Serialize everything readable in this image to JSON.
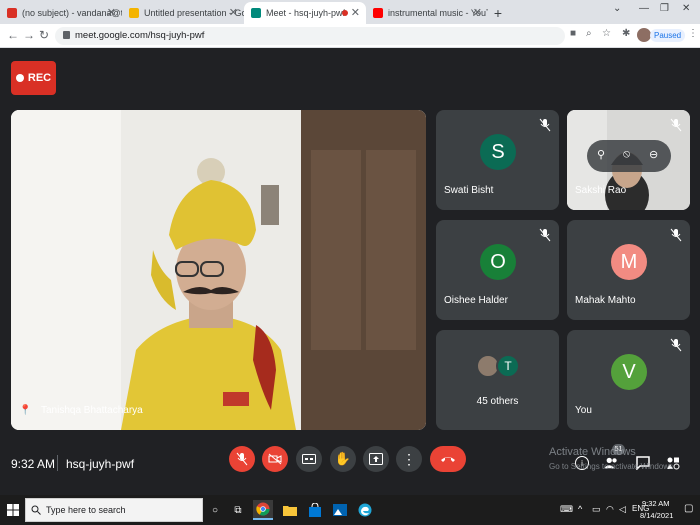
{
  "browser": {
    "tabs": [
      {
        "title": "(no subject) - vandana@theindia",
        "favicon_color": "#d93025",
        "active": false
      },
      {
        "title": "Untitled presentation - Google S",
        "favicon_color": "#f4b400",
        "active": false
      },
      {
        "title": "Meet - hsq-juyh-pwf",
        "favicon_color": "#00897b",
        "active": true
      },
      {
        "title": "instrumental music - YouTube",
        "favicon_color": "#ff0000",
        "active": false
      }
    ],
    "new_tab": "+",
    "url": "meet.google.com/hsq-juyh-pwf",
    "profile_status": "Paused"
  },
  "meet": {
    "rec_label": "REC",
    "main_participant": "Tanishqa Bhattacharya",
    "participants": [
      {
        "name": "Swati Bisht",
        "initial": "S",
        "color": "#0b6b54"
      },
      {
        "name": "Sakshi Rao",
        "initial": "",
        "color": "#d9d9d9"
      },
      {
        "name": "Oishee Halder",
        "initial": "O",
        "color": "#188038"
      },
      {
        "name": "Mahak Mahto",
        "initial": "M",
        "color": "#f28b82"
      },
      {
        "name": "45 others",
        "initial": "T",
        "color": "#0b6b54"
      },
      {
        "name": "You",
        "initial": "V",
        "color": "#54a13b"
      }
    ],
    "time": "9:32 AM",
    "meeting_code": "hsq-juyh-pwf",
    "people_count": "51",
    "activate_title": "Activate Windows",
    "activate_sub": "Go to Settings to activate Windows."
  },
  "taskbar": {
    "search_placeholder": "Type here to search",
    "time": "9:32 AM",
    "date": "8/14/2021"
  }
}
